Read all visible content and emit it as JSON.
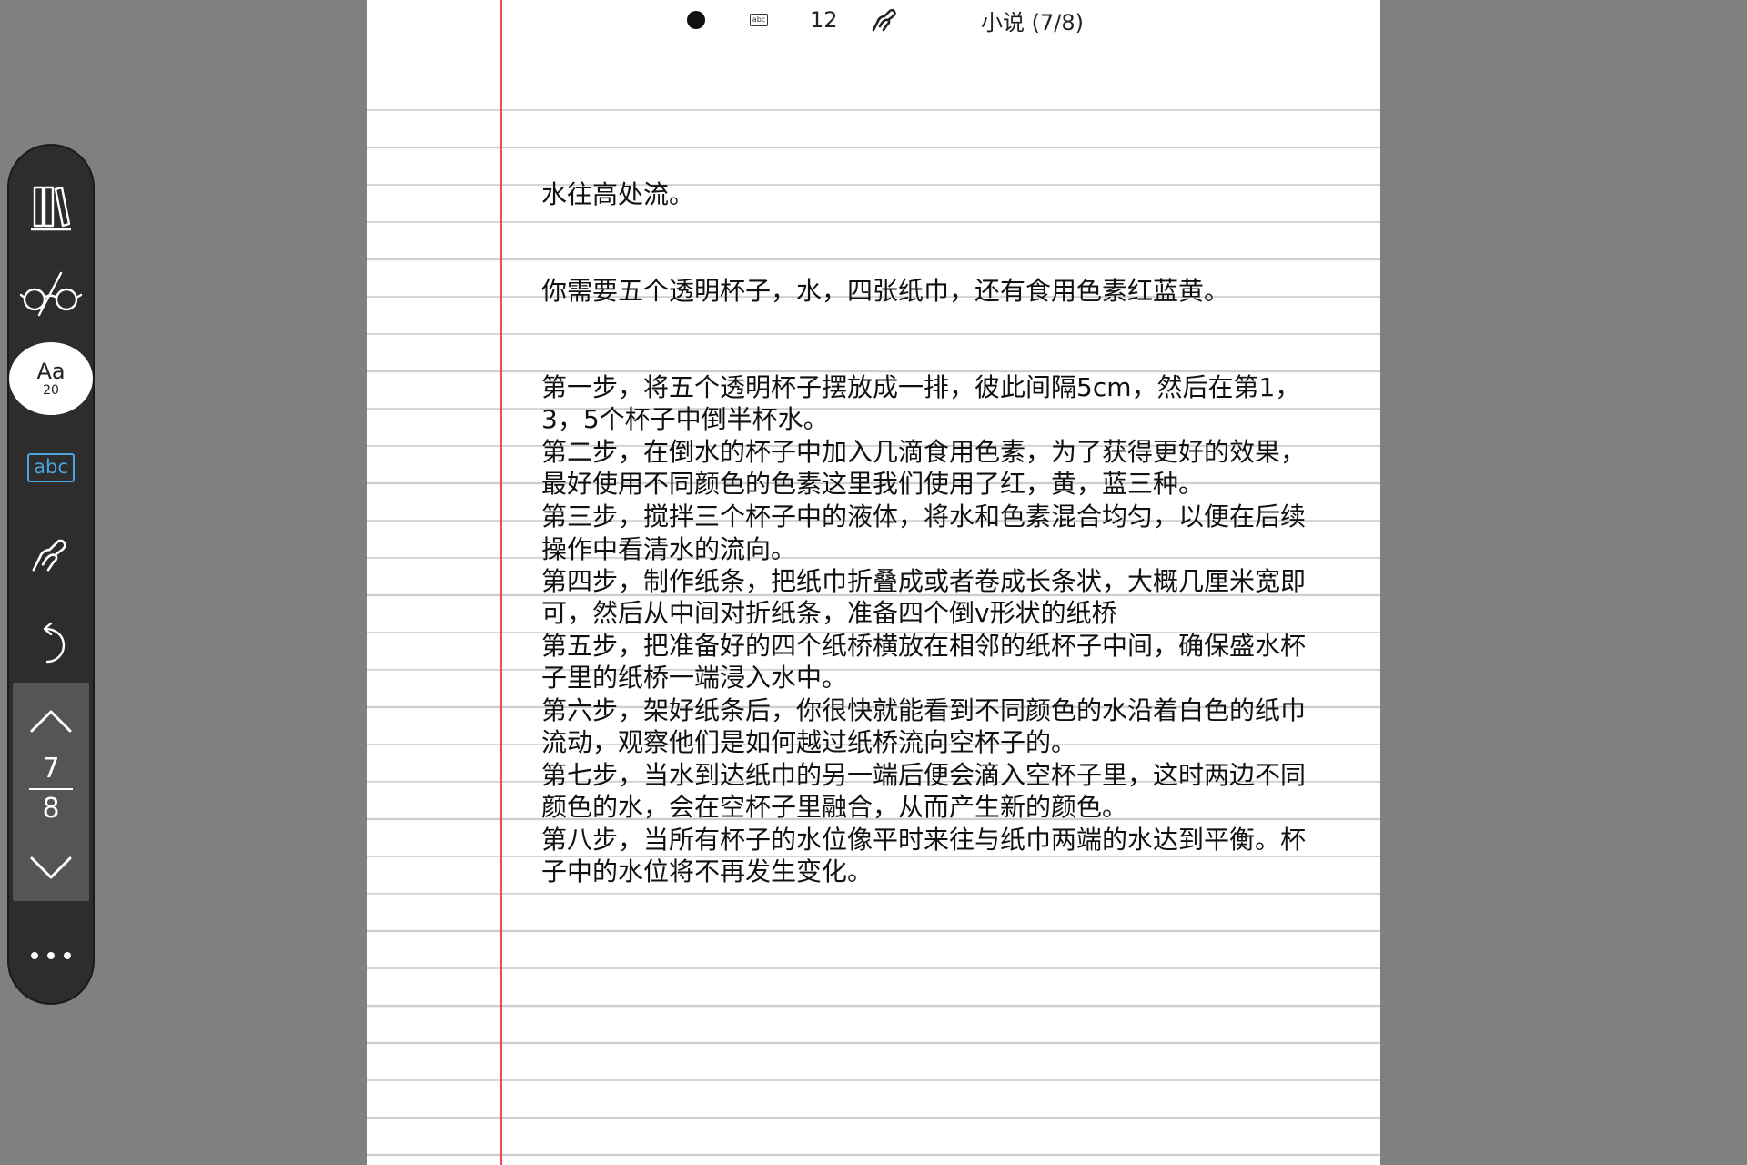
{
  "status_bar": {
    "page_number": "12",
    "book_title": "小说 (7/8)",
    "abc_label": "abc"
  },
  "toolbar": {
    "font_button": {
      "label": "Aa",
      "size": "20"
    },
    "abc_label": "abc",
    "pager": {
      "current": "7",
      "total": "8"
    },
    "icons": {
      "library": "library-icon",
      "glasses": "glasses-icon",
      "hand": "hand-gesture-icon",
      "undo": "undo-icon",
      "up": "chevron-up-icon",
      "down": "chevron-down-icon",
      "more": "more-icon"
    }
  },
  "content": {
    "paragraphs": [
      "水往高处流。",
      "你需要五个透明杯子，水，四张纸巾，还有食用色素红蓝黄。",
      "第一步，将五个透明杯子摆放成一排，彼此间隔5cm，然后在第1，",
      "3，5个杯子中倒半杯水。",
      "第二步，在倒水的杯子中加入几滴食用色素，为了获得更好的效果，",
      "最好使用不同颜色的色素这里我们使用了红，黄，蓝三种。",
      "第三步，搅拌三个杯子中的液体，将水和色素混合均匀，以便在后续",
      "操作中看清水的流向。",
      "第四步，制作纸条，把纸巾折叠成或者卷成长条状，大概几厘米宽即",
      "可，然后从中间对折纸条，准备四个倒v形状的纸桥",
      "第五步，把准备好的四个纸桥横放在相邻的纸杯子中间，确保盛水杯",
      "子里的纸桥一端浸入水中。",
      "第六步，架好纸条后，你很快就能看到不同颜色的水沿着白色的纸巾",
      "流动，观察他们是如何越过纸桥流向空杯子的。",
      "第七步，当水到达纸巾的另一端后便会滴入空杯子里，这时两边不同",
      "颜色的水，会在空杯子里融合，从而产生新的颜色。",
      "第八步，当所有杯子的水位像平时来往与纸巾两端的水达到平衡。杯",
      "子中的水位将不再发生变化。"
    ]
  },
  "colors": {
    "background": "#808080",
    "paper": "#ffffff",
    "rule_line": "#cfcfcf",
    "margin_line": "#e3242b",
    "toolbar": "#2d2d2d",
    "pager": "#555555",
    "accent_blue": "#4aa3df"
  }
}
